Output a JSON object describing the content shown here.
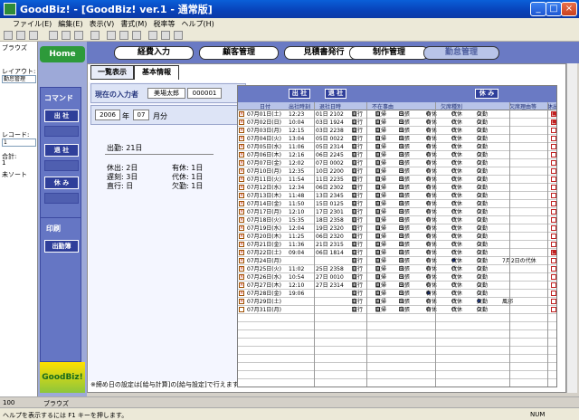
{
  "window": {
    "title": "GoodBiz! - [GoodBiz! ver.1 - 通常版]"
  },
  "menu": [
    "ファイル(E)",
    "編集(E)",
    "表示(V)",
    "書式(M)",
    "税率等",
    "ヘルプ(H)"
  ],
  "left": {
    "browse": "ブラウズ",
    "layout_label": "レイアウト:",
    "layout_value": "勤怠管理",
    "record_label": "レコード:",
    "record_value": "1",
    "total_label": "合計:",
    "total_value": "1",
    "sort": "未ソート"
  },
  "nav": {
    "home": "Home",
    "tabs": [
      "経費入力",
      "顧客管理",
      "見積書発行",
      "制作管理",
      "勤怠管理"
    ]
  },
  "commands": {
    "title": "コマンド",
    "checkin": "出 社",
    "checkout": "退 社",
    "leave": "休 み",
    "print_title": "印刷",
    "print_btn": "出勤簿"
  },
  "brand": "GoodBiz!",
  "subtabs": [
    "一覧表示",
    "基本情報"
  ],
  "person": {
    "label": "現在の入力者",
    "name": "美場太郎",
    "code": "000001"
  },
  "period": {
    "year": "2006",
    "year_unit": "年",
    "month": "07",
    "month_unit": "月分"
  },
  "stats": {
    "attend": "出勤: 21日",
    "rest": "休出: 2日",
    "late": "遅刻: 3日",
    "direct": "直行: 日",
    "paid": "有休: 1日",
    "sub": "代休: 1日",
    "absent": "欠勤: 1日"
  },
  "footnote": "※締め日の設定は[給与計算]の[給与設定]で行えます",
  "grid": {
    "btn_in": "出 社",
    "btn_out": "退 社",
    "btn_leave": "休 み",
    "headers": [
      "日付",
      "出社時刻",
      "退社日時",
      "不在事由",
      "欠席種別",
      "欠席理由等",
      "休出"
    ],
    "absence": [
      "直行",
      "直帰",
      "出張"
    ],
    "leave_types": [
      "有休",
      "代休",
      "欠勤"
    ],
    "rows": [
      {
        "x": "1",
        "date": "07月01日(土)",
        "in": "12:23",
        "out": "01日 2102",
        "sel": -1,
        "note": "",
        "hd": "1"
      },
      {
        "x": "1",
        "date": "07月02日(日)",
        "in": "10:04",
        "out": "03日 1924",
        "sel": -1,
        "note": "",
        "hd": "1"
      },
      {
        "x": "1",
        "date": "07月03日(月)",
        "in": "12:15",
        "out": "03日 2238",
        "sel": -1,
        "note": "",
        "hd": ""
      },
      {
        "x": "1",
        "date": "07月04日(火)",
        "in": "13:04",
        "out": "05日 0022",
        "sel": -1,
        "note": "",
        "hd": ""
      },
      {
        "x": "1",
        "date": "07月05日(水)",
        "in": "11:06",
        "out": "05日 2314",
        "sel": -1,
        "note": "",
        "hd": ""
      },
      {
        "x": "1",
        "date": "07月06日(木)",
        "in": "12:16",
        "out": "06日 2245",
        "sel": -1,
        "note": "",
        "hd": ""
      },
      {
        "x": "1",
        "date": "07月07日(金)",
        "in": "12:02",
        "out": "07日 0002",
        "sel": -1,
        "note": "",
        "hd": ""
      },
      {
        "x": "1",
        "date": "07月10日(月)",
        "in": "12:35",
        "out": "10日 2200",
        "sel": -1,
        "note": "",
        "hd": ""
      },
      {
        "x": "1",
        "date": "07月11日(火)",
        "in": "11:54",
        "out": "11日 2235",
        "sel": -1,
        "note": "",
        "hd": ""
      },
      {
        "x": "1",
        "date": "07月12日(水)",
        "in": "12:34",
        "out": "06日 2302",
        "sel": -1,
        "note": "",
        "hd": ""
      },
      {
        "x": "1",
        "date": "07月13日(木)",
        "in": "11:48",
        "out": "13日 2345",
        "sel": -1,
        "note": "",
        "hd": ""
      },
      {
        "x": "1",
        "date": "07月14日(金)",
        "in": "11:50",
        "out": "15日 0125",
        "sel": -1,
        "note": "",
        "hd": ""
      },
      {
        "x": "1",
        "date": "07月17日(月)",
        "in": "12:10",
        "out": "17日 2301",
        "sel": -1,
        "note": "",
        "hd": ""
      },
      {
        "x": "1",
        "date": "07月18日(火)",
        "in": "15:35",
        "out": "18日 2358",
        "sel": -1,
        "note": "",
        "hd": ""
      },
      {
        "x": "1",
        "date": "07月19日(水)",
        "in": "12:04",
        "out": "19日 2320",
        "sel": -1,
        "note": "",
        "hd": ""
      },
      {
        "x": "1",
        "date": "07月20日(木)",
        "in": "11:25",
        "out": "06日 2320",
        "sel": -1,
        "note": "",
        "hd": ""
      },
      {
        "x": "1",
        "date": "07月21日(金)",
        "in": "11:36",
        "out": "21日 2315",
        "sel": -1,
        "note": "",
        "hd": ""
      },
      {
        "x": "1",
        "date": "07月22日(土)",
        "in": "09:04",
        "out": "06日 1814",
        "sel": -1,
        "note": "",
        "hd": "1"
      },
      {
        "x": "1",
        "date": "07月24日(月)",
        "in": "",
        "out": "",
        "sel": 1,
        "note": "7月2日の代休",
        "hd": ""
      },
      {
        "x": "1",
        "date": "07月25日(火)",
        "in": "11:02",
        "out": "25日 2358",
        "sel": -1,
        "note": "",
        "hd": ""
      },
      {
        "x": "1",
        "date": "07月26日(水)",
        "in": "10:54",
        "out": "27日 0010",
        "sel": -1,
        "note": "",
        "hd": ""
      },
      {
        "x": "1",
        "date": "07月27日(木)",
        "in": "12:10",
        "out": "27日 2314",
        "sel": -1,
        "note": "",
        "hd": ""
      },
      {
        "x": "1",
        "date": "07月28日(金)",
        "in": "19:06",
        "out": "",
        "sel": 0,
        "note": "",
        "hd": ""
      },
      {
        "x": "1",
        "date": "07月29日(土)",
        "in": "",
        "out": "",
        "sel": 2,
        "note": "風邪",
        "hd": ""
      },
      {
        "x": "",
        "date": "07月31日(月)",
        "in": "",
        "out": "",
        "sel": -1,
        "note": "",
        "hd": ""
      }
    ]
  },
  "bottom": {
    "zoom": "100",
    "mode": "ブラウズ"
  },
  "status": {
    "help": "ヘルプを表示するには F1 キーを押します。",
    "num": "NUM"
  }
}
